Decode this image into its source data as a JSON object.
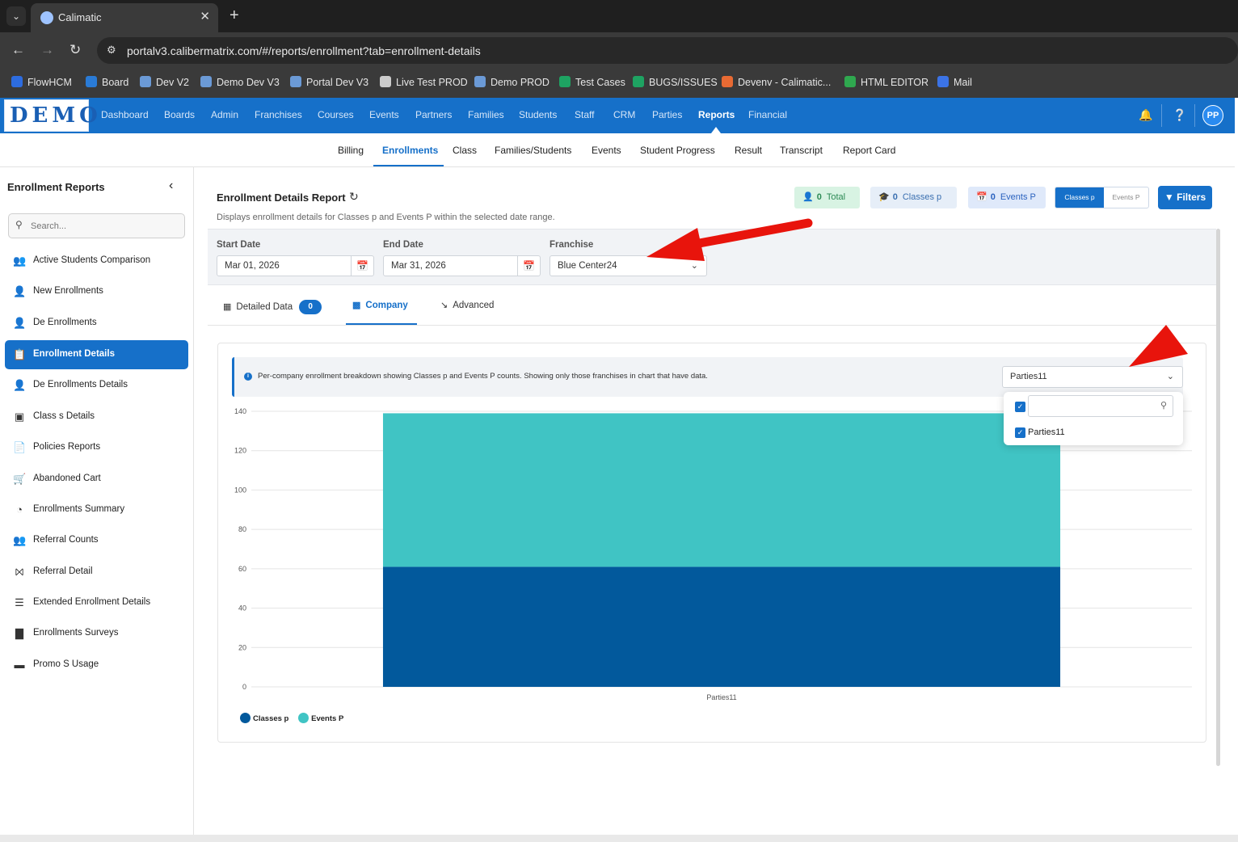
{
  "browser": {
    "tab_title": "Calimatic",
    "url": "portalv3.calibermatrix.com/#/reports/enrollment?tab=enrollment-details",
    "bookmarks": [
      "FlowHCM",
      "Board",
      "Dev V2",
      "Demo Dev V3",
      "Portal Dev V3",
      "Live Test PROD",
      "Demo PROD",
      "Test Cases",
      "BUGS/ISSUES",
      "Devenv - Calimatic...",
      "HTML EDITOR",
      "Mail"
    ]
  },
  "header": {
    "logo": "DEMO",
    "nav": [
      "Dashboard",
      "Boards",
      "Admin",
      "Franchises",
      "Courses",
      "Events",
      "Partners",
      "Families",
      "Students",
      "Staff",
      "CRM",
      "Parties",
      "Reports",
      "Financial"
    ],
    "active_nav": "Reports",
    "avatar": "PP"
  },
  "subnav": {
    "items": [
      "Billing",
      "Enrollments",
      "Class",
      "Families/Students",
      "Events",
      "Student Progress",
      "Result",
      "Transcript",
      "Report Card"
    ],
    "active": "Enrollments"
  },
  "sidebar": {
    "title": "Enrollment Reports",
    "search_placeholder": "Search...",
    "items": [
      {
        "label": "Active Students Comparison",
        "icon": "users-icon"
      },
      {
        "label": "New Enrollments",
        "icon": "user-plus-icon"
      },
      {
        "label": "De Enrollments",
        "icon": "user-minus-icon"
      },
      {
        "label": "Enrollment Details",
        "icon": "clipboard-icon"
      },
      {
        "label": "De Enrollments Details",
        "icon": "user-minus-icon"
      },
      {
        "label": "Class s Details",
        "icon": "chalkboard-icon"
      },
      {
        "label": "Policies Reports",
        "icon": "document-icon"
      },
      {
        "label": "Abandoned Cart",
        "icon": "cart-icon"
      },
      {
        "label": "Enrollments Summary",
        "icon": "pie-chart-icon"
      },
      {
        "label": "Referral Counts",
        "icon": "users-icon"
      },
      {
        "label": "Referral Detail",
        "icon": "share-icon"
      },
      {
        "label": "Extended Enrollment Details",
        "icon": "list-icon"
      },
      {
        "label": "Enrollments Surveys",
        "icon": "bar-chart-icon"
      },
      {
        "label": "Promo S Usage",
        "icon": "ticket-icon"
      }
    ],
    "active_index": 3
  },
  "report": {
    "title": "Enrollment Details Report",
    "subtitle": "Displays enrollment details for Classes p and Events P within the selected date range.",
    "stats": {
      "total_value": "0",
      "total_label": "Total",
      "classes_value": "0",
      "classes_label": "Classes p",
      "events_value": "0",
      "events_label": "Events P"
    },
    "toggle": {
      "a": "Classes p",
      "b": "Events P"
    },
    "filters_label": "Filters",
    "start_date_label": "Start Date",
    "start_date": "Mar 01, 2026",
    "end_date_label": "End Date",
    "end_date": "Mar 31, 2026",
    "franchise_label": "Franchise",
    "franchise": "Blue Center24",
    "view_tabs": {
      "detailed": "Detailed Data",
      "detailed_count": "0",
      "company": "Company",
      "advanced": "Advanced"
    },
    "info_text": "Per-company enrollment breakdown showing Classes p and Events P counts. Showing only those franchises in chart that have data.",
    "company_select": "Parties11",
    "company_options": [
      "Parties11"
    ]
  },
  "chart_data": {
    "type": "bar",
    "stacked": true,
    "categories": [
      "Parties11"
    ],
    "series": [
      {
        "name": "Classes p",
        "values": [
          61
        ],
        "color": "#02599c"
      },
      {
        "name": "Events P",
        "values": [
          78
        ],
        "color": "#40c4c4"
      }
    ],
    "ylim": [
      0,
      140
    ],
    "yticks": [
      0,
      20,
      40,
      60,
      80,
      100,
      120,
      140
    ],
    "grid": true,
    "legend": "bottom-left"
  }
}
